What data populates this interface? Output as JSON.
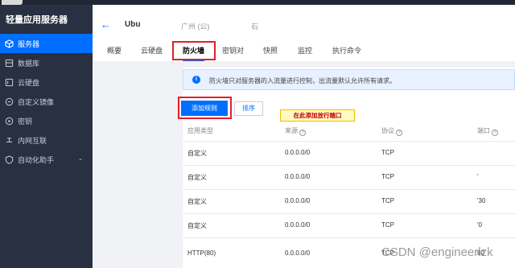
{
  "sidebar": {
    "title": "轻量应用服务器",
    "items": [
      {
        "label": "服务器",
        "icon": "cube-icon",
        "active": true
      },
      {
        "label": "数据库",
        "icon": "database-icon"
      },
      {
        "label": "云硬盘",
        "icon": "disk-icon"
      },
      {
        "label": "自定义镜像",
        "icon": "image-icon"
      },
      {
        "label": "密钥",
        "icon": "key-icon"
      },
      {
        "label": "内网互联",
        "icon": "network-icon"
      },
      {
        "label": "自动化助手",
        "icon": "automation-icon",
        "caret": "⌄"
      }
    ]
  },
  "header": {
    "back_icon": "←",
    "name": "Ubu",
    "region": "广州 (公)",
    "extra": "石"
  },
  "tabs": [
    "概要",
    "云硬盘",
    "防火墙",
    "密钥对",
    "快照",
    "监控",
    "执行命令"
  ],
  "active_tab": "防火墙",
  "firewall": {
    "info_text": "防火墙只对服务器的入流量进行控制，出流量默认允许所有请求。",
    "add_button": "添加规则",
    "sort_button": "排序",
    "annotation": "在此添加放行端口",
    "columns": [
      "应用类型",
      "来源",
      "协议",
      "端口"
    ],
    "rows": [
      {
        "app": "自定义",
        "source": "0.0.0.0/0",
        "protocol": "TCP",
        "port": ""
      },
      {
        "app": "自定义",
        "source": "0.0.0.0/0",
        "protocol": "TCP",
        "port": "'"
      },
      {
        "app": "自定义",
        "source": "0.0.0.0/0",
        "protocol": "TCP",
        "port": "'30"
      },
      {
        "app": "自定义",
        "source": "0.0.0.0/0",
        "protocol": "TCP",
        "port": "'0"
      },
      {
        "app": "HTTP(80)",
        "source": "0.0.0.0/0",
        "protocol": "TCP",
        "port": "80"
      }
    ]
  },
  "watermark": "CSDN @engineerlzk",
  "colors": {
    "accent": "#006eff",
    "sidebar_bg": "#283041",
    "highlight": "#e0202b"
  }
}
